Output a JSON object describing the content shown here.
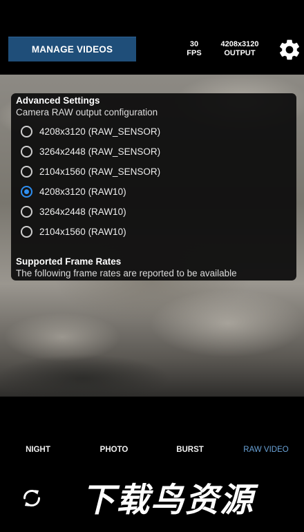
{
  "header": {
    "manage_videos_label": "MANAGE VIDEOS",
    "fps_value": "30",
    "fps_unit": "FPS",
    "output_value": "4208x3120",
    "output_unit": "OUTPUT",
    "settings_icon": "gear-icon"
  },
  "settings_panel": {
    "title": "Advanced Settings",
    "subtitle": "Camera RAW output configuration",
    "options": [
      {
        "label": "4208x3120 (RAW_SENSOR)",
        "selected": false
      },
      {
        "label": "3264x2448 (RAW_SENSOR)",
        "selected": false
      },
      {
        "label": "2104x1560 (RAW_SENSOR)",
        "selected": false
      },
      {
        "label": "4208x3120 (RAW10)",
        "selected": true
      },
      {
        "label": "3264x2448 (RAW10)",
        "selected": false
      },
      {
        "label": "2104x1560 (RAW10)",
        "selected": false
      }
    ],
    "frame_rates_title": "Supported Frame Rates",
    "frame_rates_desc": "The following frame rates are reported to be available"
  },
  "modes": {
    "tabs": [
      {
        "label": "NIGHT",
        "active": false
      },
      {
        "label": "PHOTO",
        "active": false
      },
      {
        "label": "BURST",
        "active": false
      },
      {
        "label": "RAW VIDEO",
        "active": true
      }
    ]
  },
  "footer": {
    "flip_camera_icon": "switch-camera-icon",
    "watermark": "下载鸟资源"
  },
  "colors": {
    "accent": "#2f8ff0",
    "active_tab": "#6aa3d8",
    "manage_button": "#1f4e79"
  }
}
